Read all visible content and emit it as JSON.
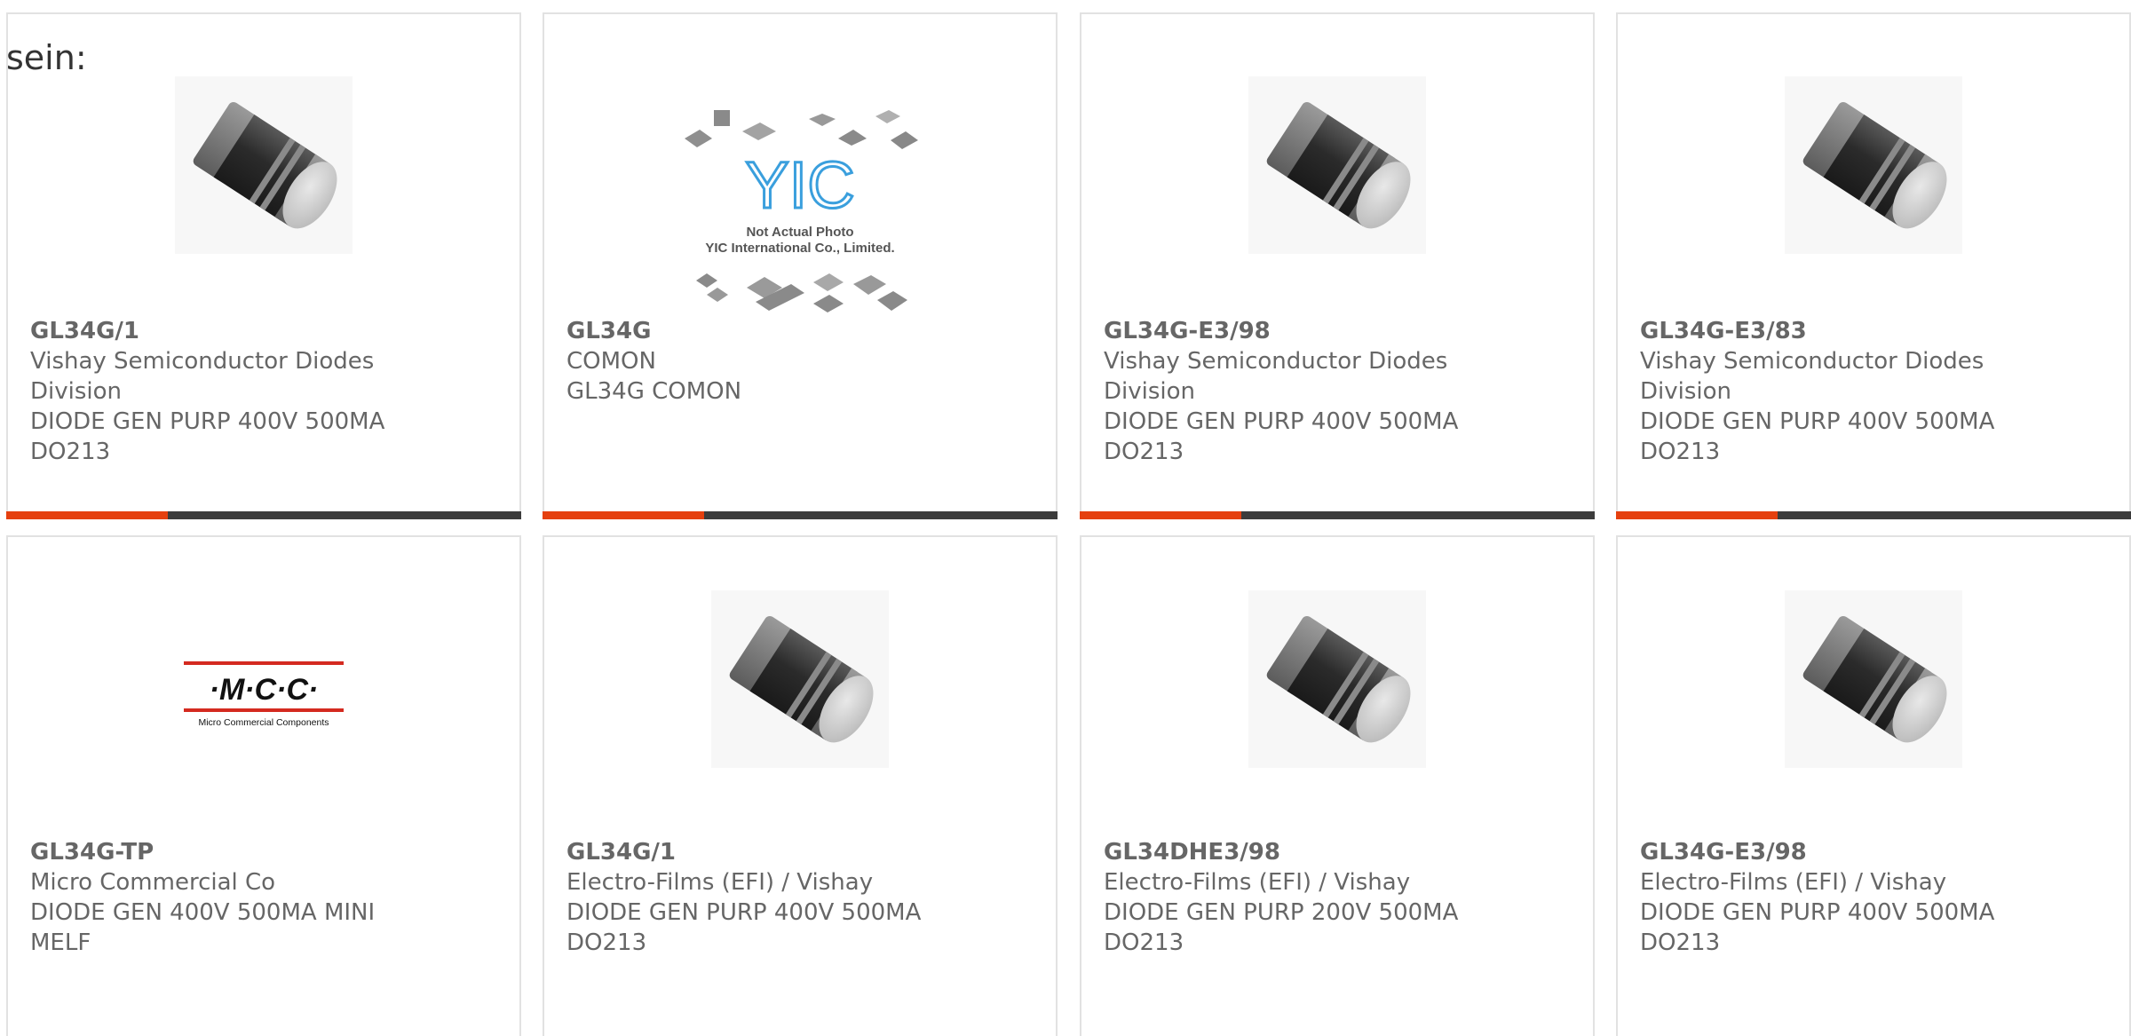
{
  "intro_text": "sein:",
  "colors": {
    "accent": "#e5400f",
    "bar": "#3c3c3c",
    "text": "#666666",
    "border": "#e2e2e2"
  },
  "placeholder": {
    "brand": "YIC",
    "line1": "Not Actual Photo",
    "line2": "YIC International Co., Limited."
  },
  "mcc_logo": {
    "mark": "·M·C·C·",
    "subtitle": "Micro Commercial Components"
  },
  "products": [
    {
      "part": "GL34G/1",
      "manufacturer": "Vishay Semiconductor Diodes Division",
      "description": "DIODE GEN PURP 400V 500MA DO213",
      "image": "diode"
    },
    {
      "part": "GL34G",
      "manufacturer": "COMON",
      "description": "GL34G COMON",
      "image": "yic-placeholder"
    },
    {
      "part": "GL34G-E3/98",
      "manufacturer": "Vishay Semiconductor Diodes Division",
      "description": "DIODE GEN PURP 400V 500MA DO213",
      "image": "diode"
    },
    {
      "part": "GL34G-E3/83",
      "manufacturer": "Vishay Semiconductor Diodes Division",
      "description": "DIODE GEN PURP 400V 500MA DO213",
      "image": "diode"
    },
    {
      "part": "GL34G-TP",
      "manufacturer": "Micro Commercial Co",
      "description": "DIODE GEN 400V 500MA MINI MELF",
      "image": "mcc-logo"
    },
    {
      "part": "GL34G/1",
      "manufacturer": "Electro-Films (EFI) / Vishay",
      "description": "DIODE GEN PURP 400V 500MA DO213",
      "image": "diode"
    },
    {
      "part": "GL34DHE3/98",
      "manufacturer": "Electro-Films (EFI) / Vishay",
      "description": "DIODE GEN PURP 200V 500MA DO213",
      "image": "diode"
    },
    {
      "part": "GL34G-E3/98",
      "manufacturer": "Electro-Films (EFI) / Vishay",
      "description": "DIODE GEN PURP 400V 500MA DO213",
      "image": "diode"
    }
  ]
}
